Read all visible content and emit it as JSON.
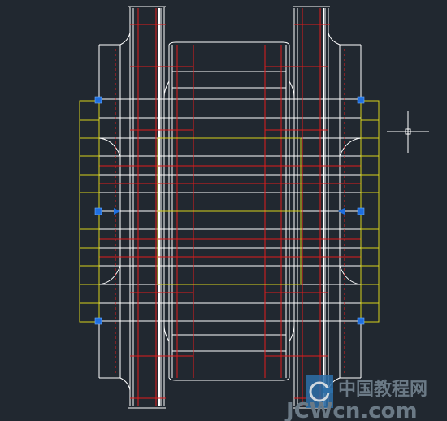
{
  "app": {
    "view": "model-space-drawing"
  },
  "colors": {
    "background": "#212830",
    "geometry": "#ffffff",
    "hidden_lines": "#e11b1b",
    "selection": "#d7d21c",
    "grip": "#1f6fe0"
  },
  "drawing": {
    "grips": [
      "grip-left-top",
      "grip-left-middle",
      "grip-left-bottom",
      "grip-right-top",
      "grip-right-middle",
      "grip-right-bottom"
    ],
    "crosshair": "crosshair-cursor"
  },
  "watermark": {
    "text_top": "中国教程网",
    "text_main": "JCWcn.com",
    "icon": "logo-icon"
  }
}
